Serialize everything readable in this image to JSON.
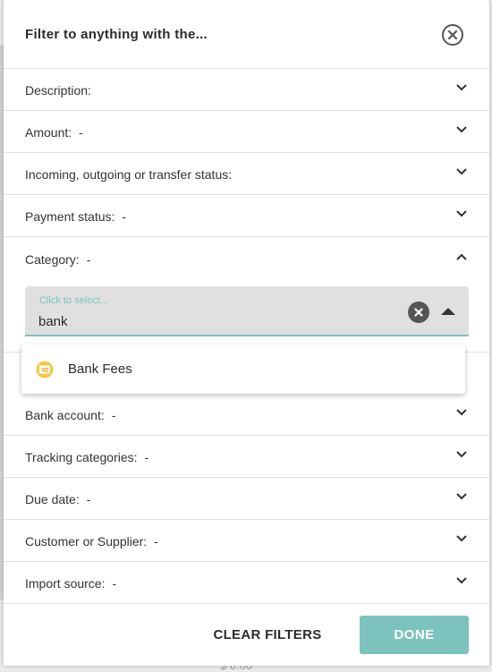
{
  "modal": {
    "title": "Filter to anything with the...",
    "close_icon": "close-circle-icon"
  },
  "filters": [
    {
      "label": "Description:",
      "value": "",
      "expanded": false
    },
    {
      "label": "Amount:",
      "value": "-",
      "expanded": false
    },
    {
      "label": "Incoming, outgoing or transfer status:",
      "value": "",
      "expanded": false
    },
    {
      "label": "Payment status:",
      "value": "-",
      "expanded": false
    },
    {
      "label": "Category:",
      "value": "-",
      "expanded": true
    },
    {
      "label": "Bank account:",
      "value": "-",
      "expanded": false
    },
    {
      "label": "Tracking categories:",
      "value": "-",
      "expanded": false
    },
    {
      "label": "Due date:",
      "value": "-",
      "expanded": false
    },
    {
      "label": "Customer or Supplier:",
      "value": "-",
      "expanded": false
    },
    {
      "label": "Import source:",
      "value": "-",
      "expanded": false
    }
  ],
  "category_select": {
    "placeholder": "Click to select...",
    "query": "bank",
    "options": [
      {
        "label": "Bank Fees",
        "icon": "bank-fees-icon"
      }
    ]
  },
  "footer": {
    "clear_label": "CLEAR FILTERS",
    "done_label": "DONE"
  },
  "background": {
    "amount_text": "$ 0.00"
  },
  "colors": {
    "accent": "#7cc3bd",
    "select_bg": "#e0e0e0",
    "icon_yellow": "#f2c94c"
  }
}
